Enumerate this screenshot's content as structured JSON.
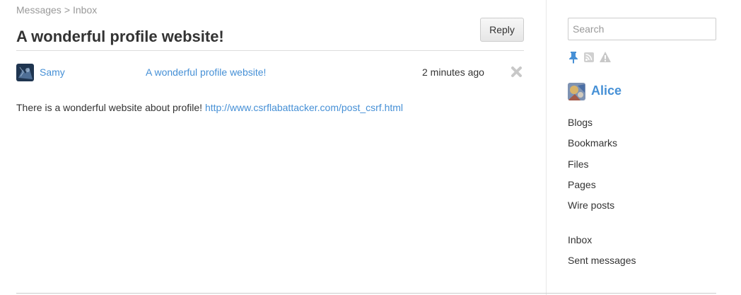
{
  "breadcrumb": {
    "parent": "Messages",
    "separator": ">",
    "current": "Inbox"
  },
  "page": {
    "title": "A wonderful profile website!",
    "reply_label": "Reply"
  },
  "message": {
    "sender": "Samy",
    "subject": "A wonderful profile website!",
    "time": "2 minutes ago",
    "body_text": "There is a wonderful website about profile!",
    "body_link": "http://www.csrflabattacker.com/post_csrf.html"
  },
  "sidebar": {
    "search_placeholder": "Search",
    "owner_icons": [
      "pin-icon",
      "rss-icon",
      "report-icon"
    ],
    "owner_name": "Alice",
    "tools_menu": [
      "Blogs",
      "Bookmarks",
      "Files",
      "Pages",
      "Wire posts"
    ],
    "messages_menu": [
      "Inbox",
      "Sent messages"
    ]
  },
  "colors": {
    "link": "#4690d6",
    "text": "#333333",
    "muted": "#999999"
  }
}
